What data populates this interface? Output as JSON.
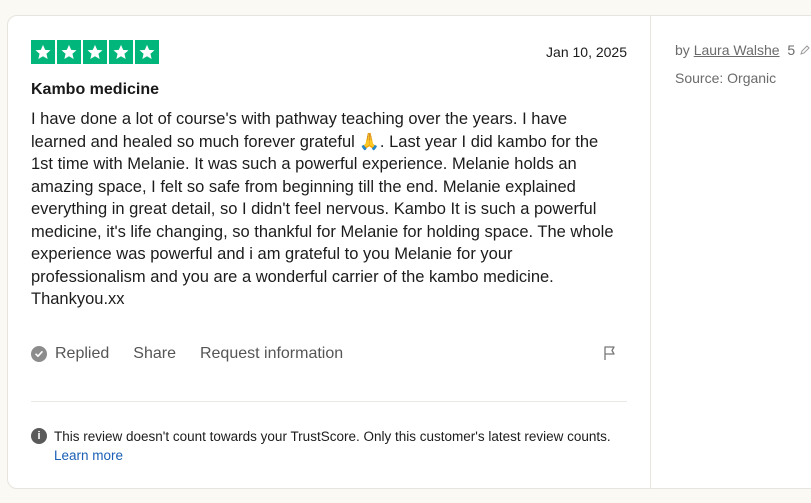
{
  "review": {
    "rating": 5,
    "date": "Jan 10, 2025",
    "title": "Kambo medicine",
    "body": "I have done a lot of course's with pathway teaching over the years. I have\nlearned and healed so much forever grateful 🙏. Last year I did kambo for the\n1st time with Melanie. It was such a powerful experience. Melanie holds an\namazing space, I felt so safe from beginning till the end. Melanie explained\neverything in great detail, so I didn't feel nervous. Kambo It is such a powerful\nmedicine, it's life changing, so thankful for Melanie for holding space. The whole\nexperience was powerful and i am grateful to you Melanie for your\nprofessionalism and you are a wonderful carrier of the kambo medicine.\nThankyou.xx"
  },
  "actions": {
    "replied_label": "Replied",
    "share_label": "Share",
    "request_label": "Request information"
  },
  "notice": {
    "text": "This review doesn't count towards your TrustScore. Only this customer's latest review counts.",
    "link": "Learn more"
  },
  "sidebar": {
    "by_prefix": "by",
    "author": "Laura Walshe",
    "count": "5",
    "source": "Source: Organic"
  },
  "colors": {
    "star_green": "#00b67a",
    "link_blue": "#1a5fb4"
  },
  "icons": [
    "star-icon",
    "check-circle-icon",
    "flag-icon",
    "info-icon",
    "pencil-icon"
  ]
}
